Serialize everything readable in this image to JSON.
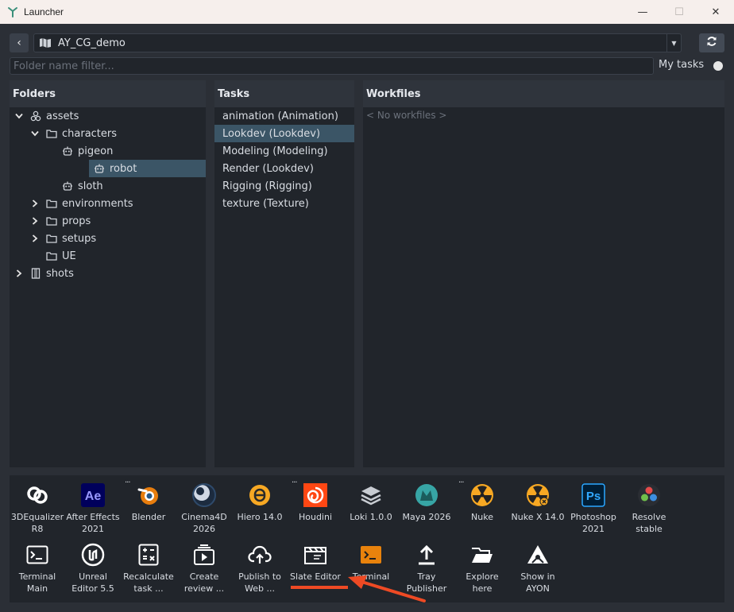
{
  "window": {
    "title": "Launcher",
    "minimize": "—",
    "maximize": "☐",
    "close": "✕"
  },
  "project": {
    "back": "‹",
    "name": "AY_CG_demo",
    "dropdown": "▼"
  },
  "filter": {
    "placeholder": "Folder name filter...",
    "my_tasks_label": "My tasks"
  },
  "folders": {
    "header": "Folders",
    "items": [
      {
        "label": "assets",
        "expanded": true,
        "icon": "cubes-icon",
        "depth": 0
      },
      {
        "label": "characters",
        "expanded": true,
        "icon": "folder-icon",
        "depth": 1
      },
      {
        "label": "pigeon",
        "icon": "robot-icon",
        "depth": 2
      },
      {
        "label": "robot",
        "icon": "robot-icon",
        "depth": 2,
        "selected": true
      },
      {
        "label": "sloth",
        "icon": "robot-icon",
        "depth": 2
      },
      {
        "label": "environments",
        "expanded": false,
        "icon": "folder-icon",
        "depth": 1
      },
      {
        "label": "props",
        "expanded": false,
        "icon": "folder-icon",
        "depth": 1
      },
      {
        "label": "setups",
        "expanded": false,
        "icon": "folder-icon",
        "depth": 1
      },
      {
        "label": "UE",
        "icon": "folder-icon",
        "depth": 1
      },
      {
        "label": "shots",
        "expanded": false,
        "icon": "film-icon",
        "depth": 0
      }
    ]
  },
  "tasks": {
    "header": "Tasks",
    "items": [
      "animation (Animation)",
      "Lookdev (Lookdev)",
      "Modeling (Modeling)",
      "Render (Lookdev)",
      "Rigging (Rigging)",
      "texture (Texture)"
    ],
    "selected_index": 1
  },
  "workfiles": {
    "header": "Workfiles",
    "empty": "< No workfiles >"
  },
  "apps_row1": [
    {
      "l1": "3DEqualizer",
      "l2": "R8",
      "icon": "3dequalizer-icon"
    },
    {
      "l1": "After Effects",
      "l2": "2021",
      "icon": "after-effects-icon",
      "badge": "Ae"
    },
    {
      "l1": "Blender",
      "l2": "",
      "icon": "blender-icon",
      "more": "..."
    },
    {
      "l1": "Cinema4D",
      "l2": "2026",
      "icon": "cinema4d-icon"
    },
    {
      "l1": "Hiero 14.0",
      "l2": "",
      "icon": "hiero-icon"
    },
    {
      "l1": "Houdini",
      "l2": "",
      "icon": "houdini-icon",
      "more": "..."
    },
    {
      "l1": "Loki 1.0.0",
      "l2": "",
      "icon": "loki-icon"
    },
    {
      "l1": "Maya 2026",
      "l2": "",
      "icon": "maya-icon"
    },
    {
      "l1": "Nuke",
      "l2": "",
      "icon": "nuke-icon",
      "more": "..."
    },
    {
      "l1": "Nuke X 14.0",
      "l2": "",
      "icon": "nukex-icon"
    },
    {
      "l1": "Photoshop",
      "l2": "2021",
      "icon": "photoshop-icon",
      "badge": "Ps"
    },
    {
      "l1": "Resolve",
      "l2": "stable",
      "icon": "resolve-icon"
    }
  ],
  "apps_row2": [
    {
      "l1": "Terminal",
      "l2": "Main",
      "icon": "terminal-icon"
    },
    {
      "l1": "Unreal",
      "l2": "Editor 5.5",
      "icon": "unreal-icon"
    },
    {
      "l1": "Recalculate",
      "l2": "task ...",
      "icon": "calculator-icon"
    },
    {
      "l1": "Create",
      "l2": "review ...",
      "icon": "review-icon"
    },
    {
      "l1": "Publish to",
      "l2": "Web ...",
      "icon": "cloud-upload-icon"
    },
    {
      "l1": "Slate Editor",
      "l2": "",
      "icon": "clapperboard-icon"
    },
    {
      "l1": "Terminal",
      "l2": "",
      "icon": "terminal-orange-icon"
    },
    {
      "l1": "Tray",
      "l2": "Publisher",
      "icon": "upload-icon"
    },
    {
      "l1": "Explore",
      "l2": "here",
      "icon": "folder-open-icon"
    },
    {
      "l1": "Show in",
      "l2": "AYON",
      "icon": "ayon-icon"
    }
  ],
  "colors": {
    "accent_selected": "#3b5566",
    "annotation": "#ee4a24"
  }
}
